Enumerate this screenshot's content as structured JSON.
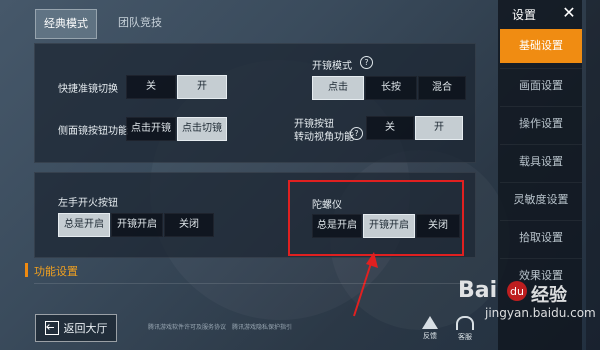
{
  "mode_tabs": [
    {
      "label": "经典模式",
      "active": true
    },
    {
      "label": "团队竞技",
      "active": false
    }
  ],
  "section1": {
    "quick_scope": {
      "label": "快捷准镜切换",
      "options": [
        "关",
        "开"
      ],
      "selected": "开"
    },
    "side_scope": {
      "label": "侧面镜按钮功能",
      "options": [
        "点击开镜",
        "点击切镜"
      ],
      "selected": "点击切镜"
    },
    "scope_mode": {
      "label": "开镜模式",
      "options": [
        "点击",
        "长按",
        "混合"
      ],
      "selected": "点击"
    },
    "scope_btn_view": {
      "label": "开镜按钮\n转动视角功能",
      "label_line1": "开镜按钮",
      "label_line2": "转动视角功能",
      "options": [
        "关",
        "开"
      ],
      "selected": "开"
    }
  },
  "section2": {
    "left_fire": {
      "label": "左手开火按钮",
      "options": [
        "总是开启",
        "开镜开启",
        "关闭"
      ],
      "selected": "总是开启"
    },
    "gyroscope": {
      "label": "陀螺仪",
      "options": [
        "总是开启",
        "开镜开启",
        "关闭"
      ],
      "selected": "开镜开启"
    }
  },
  "function_section": {
    "title": "功能设置"
  },
  "back_button": {
    "label": "返回大厅"
  },
  "notes": [
    "腾讯游戏软件许可及服务协议",
    "腾讯游戏隐私保护指引"
  ],
  "corner_buttons": [
    {
      "label": "反馈"
    },
    {
      "label": "客服"
    }
  ],
  "sidebar": {
    "title": "设置",
    "close_label": "✕",
    "items": [
      {
        "label": "基础设置",
        "active": true
      },
      {
        "label": "画面设置",
        "active": false
      },
      {
        "label": "操作设置",
        "active": false
      },
      {
        "label": "载具设置",
        "active": false
      },
      {
        "label": "灵敏度设置",
        "active": false
      },
      {
        "label": "拾取设置",
        "active": false
      },
      {
        "label": "效果设置",
        "active": false
      }
    ]
  },
  "watermark": {
    "brand": "Bai",
    "brand2": "经验",
    "url": "jingyan.baidu.com"
  },
  "colors": {
    "accent": "#f08c12",
    "annotation": "#e02020",
    "selected_option": "#c5cdd2"
  }
}
